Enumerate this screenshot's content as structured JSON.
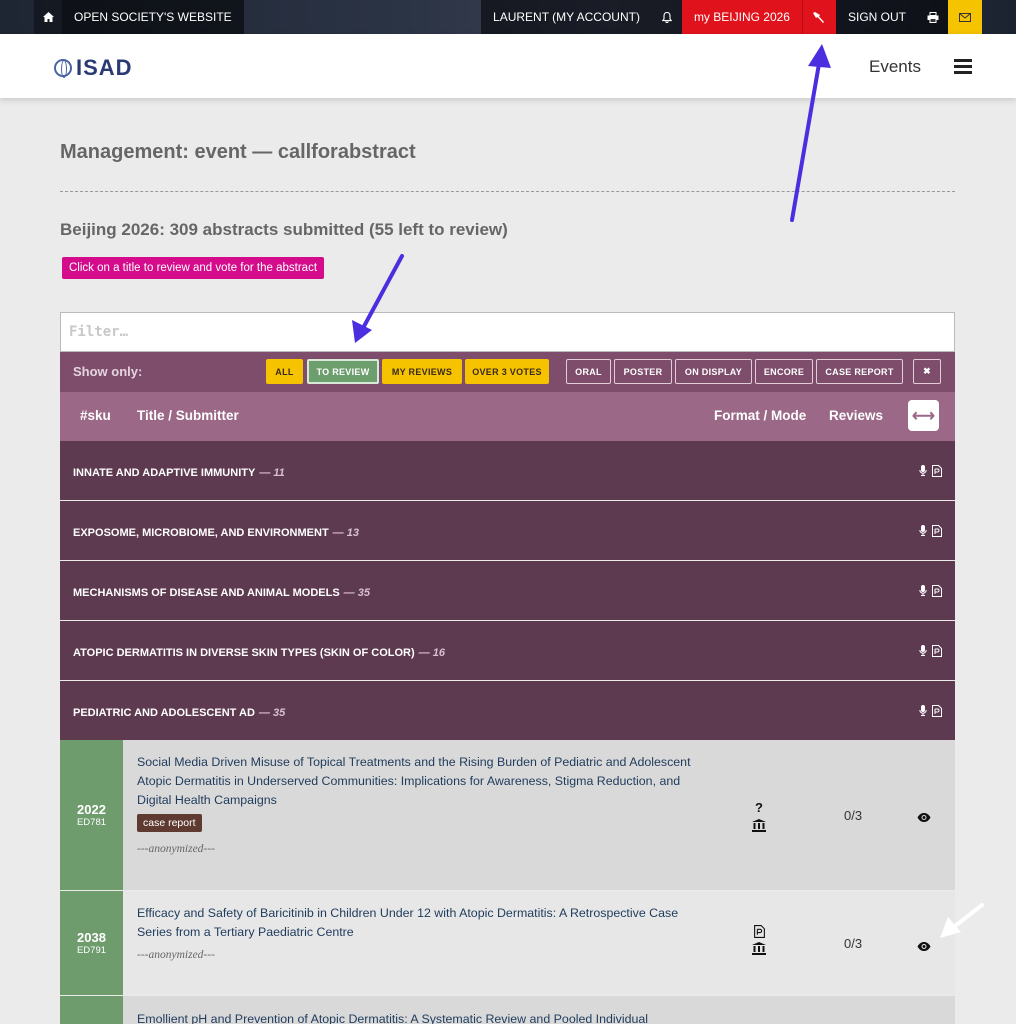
{
  "topbar": {
    "website": "OPEN SOCIETY'S WEBSITE",
    "account": "LAURENT (MY ACCOUNT)",
    "my_event": "my BEIJING 2026",
    "sign_out": "SIGN OUT"
  },
  "header": {
    "logo_text": "ISAD",
    "nav_events": "Events"
  },
  "page": {
    "title": "Management: event — callforabstract",
    "subtitle": "Beijing 2026: 309 abstracts submitted (55 left to review)",
    "hint": "Click on a title to review and vote for the abstract"
  },
  "filter": {
    "placeholder": "Filter…"
  },
  "show_only": {
    "label": "Show only:",
    "buttons": [
      "ALL",
      "TO REVIEW",
      "MY REVIEWS",
      "OVER 3 VOTES",
      "ORAL",
      "POSTER",
      "ON DISPLAY",
      "ENCORE",
      "CASE REPORT",
      "✖"
    ]
  },
  "table_head": {
    "sku": "#sku",
    "title": "Title / Submitter",
    "format": "Format / Mode",
    "reviews": "Reviews",
    "expand_glyph": "⟷"
  },
  "categories": [
    {
      "name": "INNATE AND ADAPTIVE IMMUNITY",
      "count": "— 11"
    },
    {
      "name": "EXPOSOME, MICROBIOME, AND ENVIRONMENT",
      "count": "— 13"
    },
    {
      "name": "MECHANISMS OF DISEASE AND ANIMAL MODELS",
      "count": "— 35"
    },
    {
      "name": "ATOPIC DERMATITIS IN DIVERSE SKIN TYPES (SKIN OF COLOR)",
      "count": "— 16"
    },
    {
      "name": "PEDIATRIC AND ADOLESCENT AD",
      "count": "— 35"
    }
  ],
  "rows": [
    {
      "sku": "2022",
      "code": "ED781",
      "title": "Social Media Driven Misuse of Topical Treatments and the Rising Burden of Pediatric and Adolescent Atopic Dermatitis in Underserved Communities: Implications for Awareness, Stigma Reduction, and Digital Health Campaigns",
      "badge": "case report",
      "submitter": "---anonymized---",
      "format_icon": "?",
      "reviews": "0/3"
    },
    {
      "sku": "2038",
      "code": "ED791",
      "title": "Efficacy and Safety of Baricitinib in Children Under 12 with Atopic Dermatitis: A Retrospective Case Series from a Tertiary Paediatric Centre",
      "submitter": "---anonymized---",
      "reviews": "0/3"
    },
    {
      "title": "Emollient pH and Prevention of Atopic Dermatitis: A Systematic Review and Pooled Individual"
    }
  ],
  "colors": {
    "accent_red": "#e0131c",
    "accent_yellow": "#f5c300",
    "plum_dark": "#5e3a50",
    "plum_mid": "#7d4d6b",
    "plum_light": "#9b6887",
    "sku_green": "#6e9c6c",
    "hint_magenta": "#d40c8c",
    "annotation_arrow": "#4b2ee0"
  },
  "icons": [
    "home-icon",
    "bell-icon",
    "tools-icon",
    "print-icon",
    "mail-icon",
    "menu-icon",
    "microphone-icon",
    "poster-icon",
    "question-icon",
    "institution-icon",
    "eye-icon",
    "expand-icon"
  ]
}
